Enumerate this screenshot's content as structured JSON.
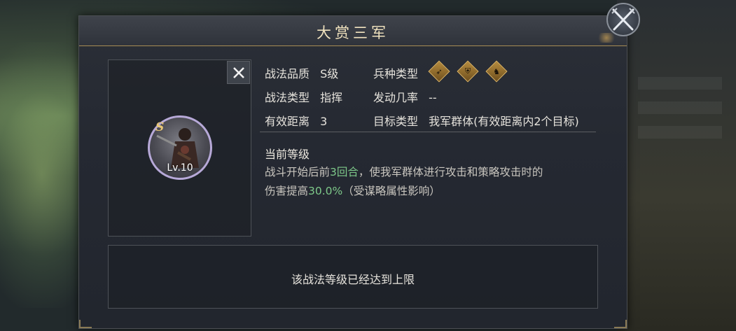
{
  "dialog": {
    "title": "大赏三军"
  },
  "skill": {
    "grade_letter": "S",
    "level": "Lv.10",
    "quality_label": "战法品质",
    "quality_value": "S级",
    "type_label": "战法类型",
    "type_value": "指挥",
    "range_label": "有效距离",
    "range_value": "3",
    "troop_label": "兵种类型",
    "troop_icons": [
      "archer-icon",
      "shield-infantry-icon",
      "cavalry-icon"
    ],
    "trigger_label": "发动几率",
    "trigger_value": "--",
    "target_label": "目标类型",
    "target_value": "我军群体(有效距离内2个目标)"
  },
  "current_level": {
    "heading": "当前等级",
    "line1_pre": "战斗开始后前",
    "line1_hl": "3回合",
    "line1_post": "，使我军群体进行攻击和策略攻击时的",
    "line2_pre": "伤害提高",
    "line2_hl": "30.0%",
    "line2_post": "（受谋略属性影响）"
  },
  "footer": {
    "max_level_text": "该战法等级已经达到上限"
  },
  "colors": {
    "highlight": "#7ec98a",
    "gold": "#e8c676",
    "title_text": "#f0e2be"
  }
}
